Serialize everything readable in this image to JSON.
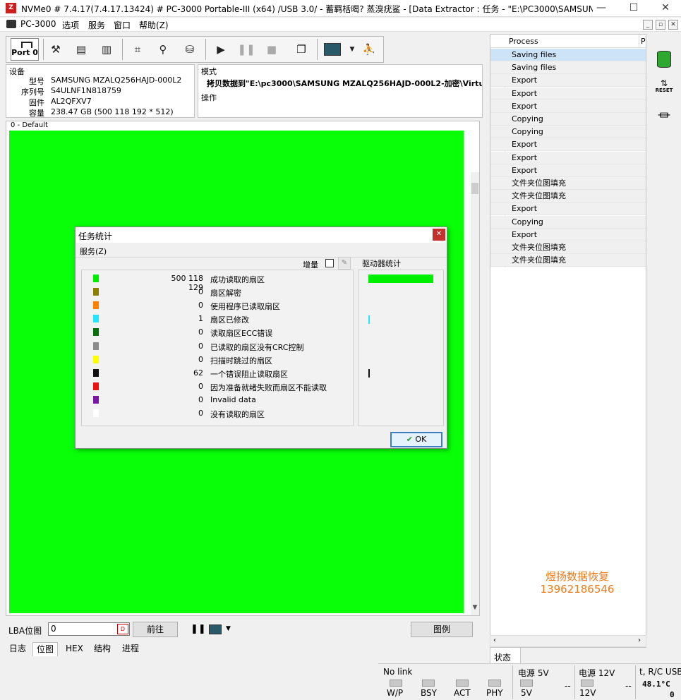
{
  "window": {
    "title": "NVMe0 # 7.4.17(7.4.17.13424) # PC-3000 Portable-III (x64) /USB 3.0/ - 蓄羁栝暍? 蒸溴疣鲨 - [Data Extractor : 任务 - \"E:\\PC3000\\SAMSUNG MZ...",
    "minimize": "—",
    "maximize": "☐",
    "close": "✕"
  },
  "menu": {
    "app": "PC-3000",
    "items": [
      "选项",
      "服务",
      "窗口",
      "帮助(Z)"
    ],
    "mdi": [
      "_",
      "▫",
      "✕"
    ]
  },
  "toolbar": {
    "port_label": "Port 0"
  },
  "device": {
    "section": "设备",
    "model_label": "型号",
    "model": "SAMSUNG MZALQ256HAJD-000L2",
    "serial_label": "序列号",
    "serial": "S4ULNF1N818759",
    "firmware_label": "固件",
    "firmware": "AL2QFXV7",
    "capacity_label": "容量",
    "capacity": "238.47 GB (500 118 192 * 512)"
  },
  "mode": {
    "section": "模式",
    "text": "拷贝数据到\"E:\\pc3000\\SAMSUNG MZALQ256HAJD-000L2-加密\\Virtu",
    "operation": "操作"
  },
  "map": {
    "legend": "0 - Default"
  },
  "lba": {
    "label": "LBA位图",
    "value": "0",
    "go": "前往",
    "legend_btn": "图例"
  },
  "tabs": [
    "日志",
    "位图",
    "HEX",
    "结构",
    "进程"
  ],
  "process": {
    "header": "Process",
    "header2": "P",
    "rows": [
      "Saving files",
      "Saving files",
      "Export",
      "Export",
      "Export",
      "Copying",
      "Copying",
      "Export",
      "Export",
      "Export",
      "文件夹位图填充",
      "文件夹位图填充",
      "Export",
      "Copying",
      "Export",
      "文件夹位图填充",
      "文件夹位图填充"
    ],
    "status_tab": "状态"
  },
  "watermark": {
    "line1": "煜扬数据恢复",
    "line2": "13962186546"
  },
  "right_icons": {
    "reset": "RESET"
  },
  "status": {
    "link": "No link",
    "leds": [
      "W/P",
      "BSY",
      "ACT",
      "PHY"
    ],
    "power5": "电源 5V",
    "power5_led": "5V",
    "power5_val": "--",
    "power12": "电源 12V",
    "power12_led": "12V",
    "power12_val": "--",
    "temp_label": "t, R/C USB",
    "temp": "48.1°C",
    "rc": "0"
  },
  "dialog": {
    "title": "任务统计",
    "menu": "服务(Z)",
    "incr_label": "增量",
    "drive_stats": "驱动器统计",
    "ok": "OK",
    "colors": [
      "#00ee00",
      "#8b8000",
      "#ff7f00",
      "#22e5ff",
      "#0b6d0b",
      "#8c8c8c",
      "#ffff00",
      "#111111",
      "#ee1111",
      "#7a16a6",
      "#ffffff"
    ],
    "stats": [
      {
        "count": "500 118 129",
        "label": "成功读取的扇区"
      },
      {
        "count": "0",
        "label": "扇区解密"
      },
      {
        "count": "0",
        "label": "使用程序已读取扇区"
      },
      {
        "count": "1",
        "label": "扇区已修改"
      },
      {
        "count": "0",
        "label": "读取扇区ECC错误"
      },
      {
        "count": "0",
        "label": "已读取的扇区没有CRC控制"
      },
      {
        "count": "0",
        "label": "扫描时跳过的扇区"
      },
      {
        "count": "62",
        "label": "一个错误阻止读取扇区"
      },
      {
        "count": "0",
        "label": "因为准备就绪失败而扇区不能读取"
      },
      {
        "count": "0",
        "label": "Invalid data"
      },
      {
        "count": "0",
        "label": "没有读取的扇区"
      }
    ]
  }
}
